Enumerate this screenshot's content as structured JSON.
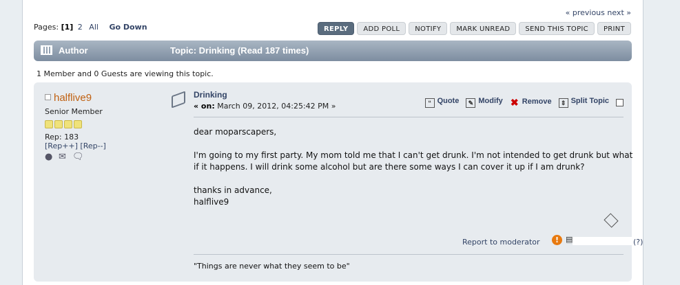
{
  "nav": {
    "previous": "« previous",
    "next": "next »"
  },
  "pagination": {
    "label": "Pages: ",
    "current": "[1]",
    "page2": "2",
    "all": "All",
    "go_down": "Go Down"
  },
  "buttons": [
    "REPLY",
    "ADD POLL",
    "NOTIFY",
    "MARK UNREAD",
    "SEND THIS TOPIC",
    "PRINT"
  ],
  "header": {
    "author": "Author",
    "topic": "Topic: Drinking  (Read 187 times)"
  },
  "viewing": "1 Member and 0 Guests are viewing this topic.",
  "poster": {
    "name": "halflive9",
    "group": "Senior Member",
    "stars": 4,
    "rep": "Rep: 183",
    "rep_plus": "[Rep++]",
    "rep_minus": "[Rep--]"
  },
  "post": {
    "subject": "Drinking",
    "posted_prefix": "« on:",
    "posted_date": "March 09, 2012, 04:25:42 PM »",
    "actions": {
      "quote": "Quote",
      "modify": "Modify",
      "remove": "Remove",
      "split": "Split Topic"
    },
    "body": [
      "dear moparscapers,",
      "I'm going to my first party. My mom told me that I can't get drunk. I'm not intended to get drunk but what if it happens. I will drink some alcohol but are there some ways I can cover it up if I am drunk?",
      "thanks in advance,",
      "halflive9"
    ],
    "report": "Report to moderator",
    "ip_help": "(?)",
    "signature": "\"Things are never what they seem to be\""
  },
  "colors": {
    "header_bar": "#8a9aac",
    "post_bg": "#e7ebef",
    "link": "#334466",
    "poster_name": "#c06010"
  }
}
